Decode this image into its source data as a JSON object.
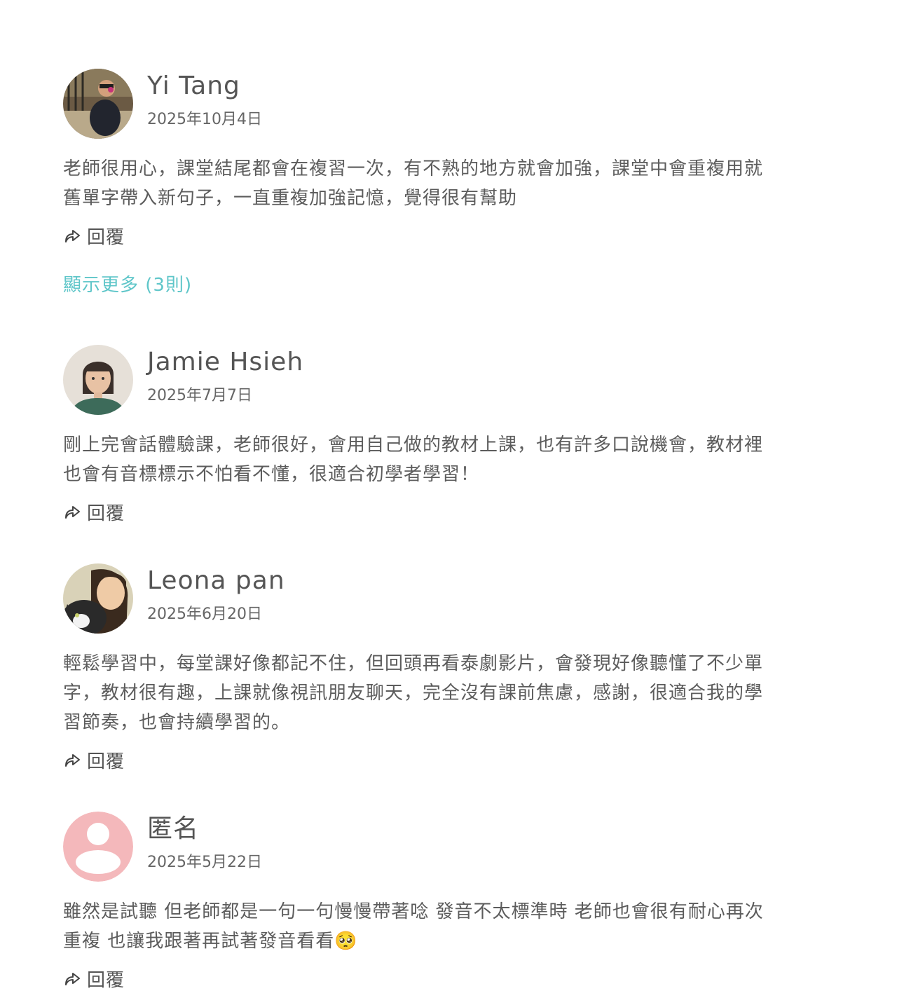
{
  "reviews": [
    {
      "name": "Yi Tang",
      "date": "2025年10月4日",
      "text": "老師很用心，課堂結尾都會在複習一次，有不熟的地方就會加強，課堂中會重複用就舊單字帶入新句子，一直重複加強記憶，覺得很有幫助",
      "reply_label": "回覆",
      "show_more": "顯示更多 (3則)"
    },
    {
      "name": "Jamie Hsieh",
      "date": "2025年7月7日",
      "text": "剛上完會話體驗課，老師很好，會用自己做的教材上課，也有許多口說機會，教材裡也會有音標標示不怕看不懂，很適合初學者學習！",
      "reply_label": "回覆"
    },
    {
      "name": "Leona pan",
      "date": "2025年6月20日",
      "text": "輕鬆學習中，每堂課好像都記不住，但回頭再看泰劇影片，會發現好像聽懂了不少單字，教材很有趣，上課就像視訊朋友聊天，完全沒有課前焦慮，感謝，很適合我的學習節奏，也會持續學習的。",
      "reply_label": "回覆"
    },
    {
      "name": "匿名",
      "date": "2025年5月22日",
      "text": "雖然是試聽 但老師都是一句一句慢慢帶著唸 發音不太標準時 老師也會很有耐心再次重複 也讓我跟著再試著發音看看🥺",
      "reply_label": "回覆"
    }
  ],
  "colors": {
    "accent": "#5fc6c9",
    "text": "#555555",
    "anonymous_avatar": "#f4b8bb"
  },
  "icons": {
    "reply": "share-arrow-icon",
    "anonymous": "user-placeholder-icon"
  }
}
